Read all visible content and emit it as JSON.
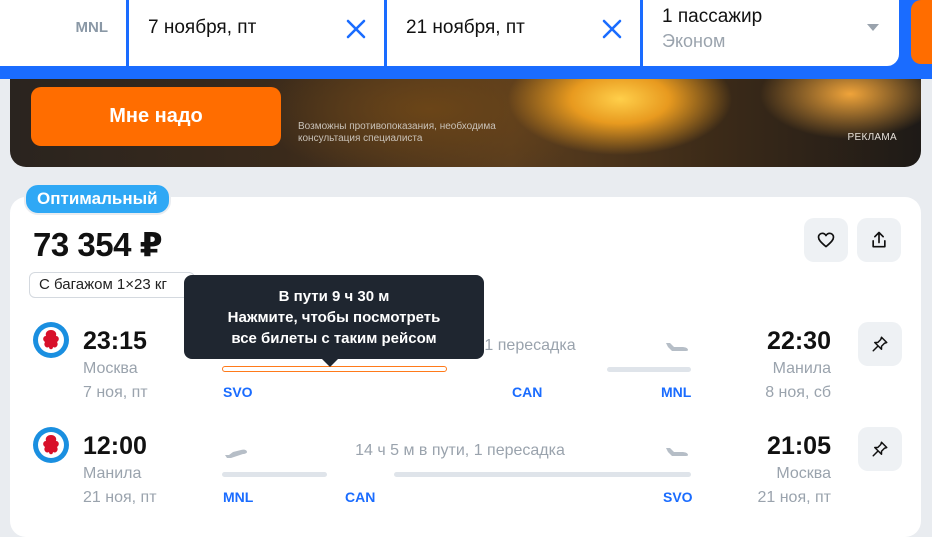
{
  "search": {
    "origin_code": "MNL",
    "depart_date": "7 ноября, пт",
    "return_date": "21 ноября, пт",
    "passengers": "1 пассажир",
    "cabin_class": "Эконом"
  },
  "ad": {
    "cta_label": "Мне надо",
    "disclaimer": "Возможны противопоказания, необходима консультация специалиста",
    "label": "РЕКЛАМА"
  },
  "ticket": {
    "badge": "Оптимальный",
    "price": "73 354 ₽",
    "baggage": "С багажом 1×23 кг",
    "tooltip": {
      "line1": "В пути 9 ч 30 м",
      "line2": "Нажмите, чтобы посмотреть",
      "line3": "все билеты с таким рейсом"
    },
    "outbound": {
      "dep_time": "23:15",
      "dep_city": "Москва",
      "dep_date": "7 ноя, пт",
      "arr_time": "22:30",
      "arr_city": "Манила",
      "arr_date": "8 ноя, сб",
      "duration_text": "1 пересадка",
      "codes": [
        "SVO",
        "CAN",
        "MNL"
      ]
    },
    "inbound": {
      "dep_time": "12:00",
      "dep_city": "Манила",
      "dep_date": "21 ноя, пт",
      "arr_time": "21:05",
      "arr_city": "Москва",
      "arr_date": "21 ноя, пт",
      "duration_text": "14 ч 5 м в пути, 1 пересадка",
      "codes": [
        "MNL",
        "CAN",
        "SVO"
      ]
    }
  },
  "colors": {
    "brand_blue": "#1a6cff",
    "accent_orange": "#ff6d00",
    "badge_blue": "#2fa8f5",
    "airline_red": "#d8102a"
  },
  "icons": [
    "close-icon",
    "chevron-down-icon",
    "heart-icon",
    "share-icon",
    "pin-icon",
    "plane-takeoff-icon",
    "plane-landing-icon",
    "airline-logo-icon"
  ]
}
